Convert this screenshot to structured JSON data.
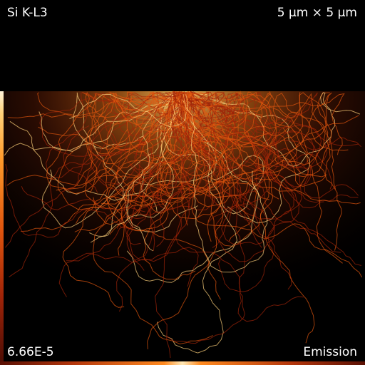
{
  "overlay": {
    "element_line": "Si K-L3",
    "field_of_view": "5 µm × 5 µm",
    "scale_value": "6.66E-5",
    "mode": "Emission"
  },
  "colors": {
    "background": "#000000",
    "trajectory_core": "#ffd27a",
    "trajectory_mid": "#e0560e",
    "trajectory_edge": "#a02408",
    "text": "#ffffff"
  }
}
